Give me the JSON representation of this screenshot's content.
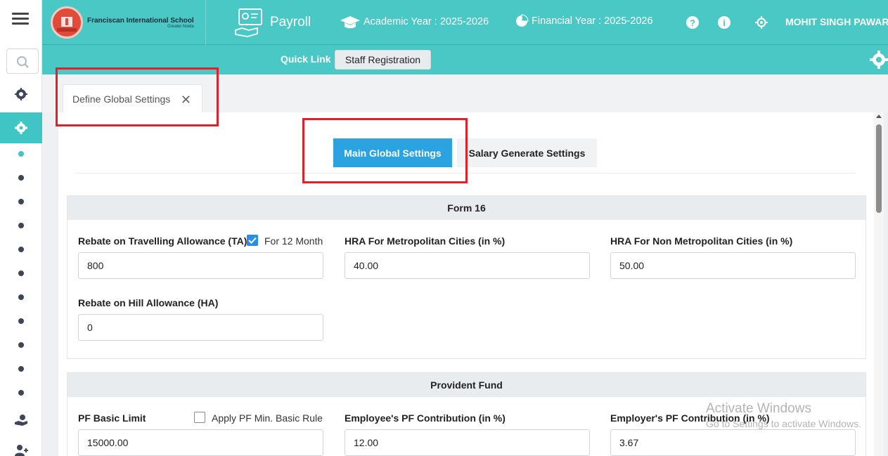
{
  "header": {
    "school_name": "Franciscan International School",
    "school_location": "Greater Noida",
    "module": "Payroll",
    "academic_year": "Academic Year : 2025-2026",
    "financial_year": "Financial Year : 2025-2026",
    "user": "MOHIT SINGH PAWAR",
    "accent_color": "#49c8c5"
  },
  "quick_link": {
    "label": "Quick Link",
    "button": "Staff Registration"
  },
  "page_tab": {
    "label": "Define Global Settings"
  },
  "sub_tabs": {
    "main": "Main Global Settings",
    "salary": "Salary Generate Settings"
  },
  "form16": {
    "title": "Form 16",
    "ta_label": "Rebate on Travelling Allowance (TA)",
    "ta_check_label": "For 12 Month",
    "ta_checked": true,
    "ta_value": "800",
    "hra_metro_label": "HRA For Metropolitan Cities (in %)",
    "hra_metro_value": "40.00",
    "hra_nonmetro_label": "HRA For Non Metropolitan Cities (in %)",
    "hra_nonmetro_value": "50.00",
    "hill_label": "Rebate on Hill Allowance (HA)",
    "hill_value": "0"
  },
  "provident_fund": {
    "title": "Provident Fund",
    "basic_limit_label": "PF Basic Limit",
    "min_basic_check_label": "Apply PF Min. Basic Rule",
    "min_basic_checked": false,
    "basic_limit_value": "15000.00",
    "employee_label": "Employee's PF Contribution (in %)",
    "employee_value": "12.00",
    "employer_label": "Employer's PF Contribution (in %)",
    "employer_value": "3.67"
  },
  "watermark": {
    "line1": "Activate Windows",
    "line2": "Go to Settings to activate Windows."
  }
}
